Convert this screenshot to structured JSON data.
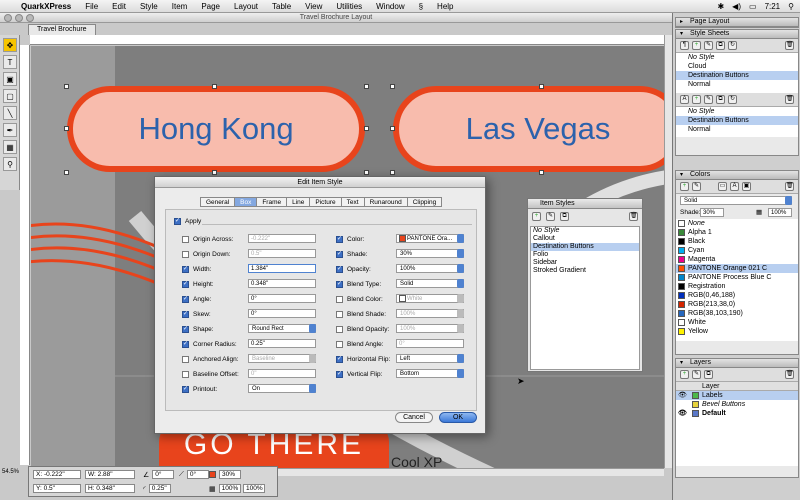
{
  "menubar": {
    "app": "QuarkXPress",
    "items": [
      "File",
      "Edit",
      "Style",
      "Item",
      "Page",
      "Layout",
      "Table",
      "View",
      "Utilities",
      "Window",
      "Help"
    ],
    "script_icon": "script-icon",
    "clock": "7:21"
  },
  "document": {
    "window_title": "Travel Brochure Layout",
    "tab": "Travel Brochure",
    "buttons": [
      {
        "label": "Hong Kong"
      },
      {
        "label": "Las Vegas"
      }
    ],
    "bottom_text": "GO THERE",
    "bottom_text2": "Cool XP",
    "zoom": "54.5%",
    "accent": "#e8441c",
    "pill_fill": "#f8bcad",
    "text_color": "#2c62ac"
  },
  "measurements": {
    "x": "X: -0.222\"",
    "y": "Y: 0.5\"",
    "w": "W: 2.88\"",
    "h": "H: 0.348\"",
    "angle": "0°",
    "angle2": "0°",
    "radius": "0.25\"",
    "shade": "30%",
    "opacity": "100%",
    "opacity2": "100%"
  },
  "dialog": {
    "title": "Edit Item Style",
    "tabs": [
      "General",
      "Box",
      "Frame",
      "Line",
      "Picture",
      "Text",
      "Runaround",
      "Clipping"
    ],
    "active_tab": "Box",
    "apply_label": "Apply",
    "left_fields": [
      {
        "label": "Origin Across:",
        "value": "-0.222\"",
        "checked": false
      },
      {
        "label": "Origin Down:",
        "value": "0.5\"",
        "checked": false
      },
      {
        "label": "Width:",
        "value": "1.384\"",
        "checked": true
      },
      {
        "label": "Height:",
        "value": "0.348\"",
        "checked": true
      },
      {
        "label": "Angle:",
        "value": "0°",
        "checked": true
      },
      {
        "label": "Skew:",
        "value": "0°",
        "checked": true
      },
      {
        "label": "Shape:",
        "value": "Round Rect",
        "checked": true
      },
      {
        "label": "Corner Radius:",
        "value": "0.25\"",
        "checked": true
      },
      {
        "label": "Anchored Align:",
        "value": "Baseline",
        "checked": false
      },
      {
        "label": "Baseline Offset:",
        "value": "0\"",
        "checked": false
      },
      {
        "label": "Printout:",
        "value": "On",
        "checked": true
      }
    ],
    "right_fields": [
      {
        "label": "Color:",
        "value": "PANTONE Ora...",
        "checked": true
      },
      {
        "label": "Shade:",
        "value": "30%",
        "checked": true
      },
      {
        "label": "Opacity:",
        "value": "100%",
        "checked": true
      },
      {
        "label": "Blend Type:",
        "value": "Solid",
        "checked": true
      },
      {
        "label": "Blend Color:",
        "value": "White",
        "checked": false
      },
      {
        "label": "Blend Shade:",
        "value": "100%",
        "checked": false
      },
      {
        "label": "Blend Opacity:",
        "value": "100%",
        "checked": false
      },
      {
        "label": "Blend Angle:",
        "value": "0°",
        "checked": false
      },
      {
        "label": "Horizontal Flip:",
        "value": "Left",
        "checked": true
      },
      {
        "label": "Vertical Flip:",
        "value": "Bottom",
        "checked": true
      }
    ],
    "cancel": "Cancel",
    "ok": "OK"
  },
  "item_styles": {
    "title": "Item Styles",
    "items": [
      "No Style",
      "Callout",
      "Destination Buttons",
      "Folio",
      "Sidebar",
      "Stroked Gradient"
    ],
    "selected": 2
  },
  "palettes": {
    "page_layout": "Page Layout",
    "style_sheets": {
      "title": "Style Sheets",
      "para": [
        "No Style",
        "Cloud",
        "Destination Buttons",
        "Normal"
      ],
      "char": [
        "No Style",
        "Destination Buttons",
        "Normal"
      ]
    },
    "colors": {
      "title": "Colors",
      "mode": "Solid",
      "shade_label": "Shade:",
      "shade": "30%",
      "opacity": "100%",
      "items": [
        {
          "name": "None",
          "color": "#ffffff"
        },
        {
          "name": "Alpha 1",
          "color": "#3a8a3a"
        },
        {
          "name": "Black",
          "color": "#000000"
        },
        {
          "name": "Cyan",
          "color": "#00aeef"
        },
        {
          "name": "Magenta",
          "color": "#ec008c"
        },
        {
          "name": "PANTONE Orange 021 C",
          "color": "#fe5000"
        },
        {
          "name": "PANTONE Process Blue C",
          "color": "#0085ca"
        },
        {
          "name": "Registration",
          "color": "#000000"
        },
        {
          "name": "RGB(0,46,188)",
          "color": "#002ebc"
        },
        {
          "name": "RGB(213,38,0)",
          "color": "#d52600"
        },
        {
          "name": "RGB(38,103,190)",
          "color": "#2667be"
        },
        {
          "name": "White",
          "color": "#ffffff"
        },
        {
          "name": "Yellow",
          "color": "#fff200"
        }
      ],
      "selected": 5
    },
    "layers": {
      "title": "Layers",
      "col": "Layer",
      "items": [
        {
          "name": "Labels",
          "style": "sel"
        },
        {
          "name": "Bevel Buttons",
          "style": "ital"
        },
        {
          "name": "Default",
          "style": "bold"
        }
      ]
    }
  }
}
